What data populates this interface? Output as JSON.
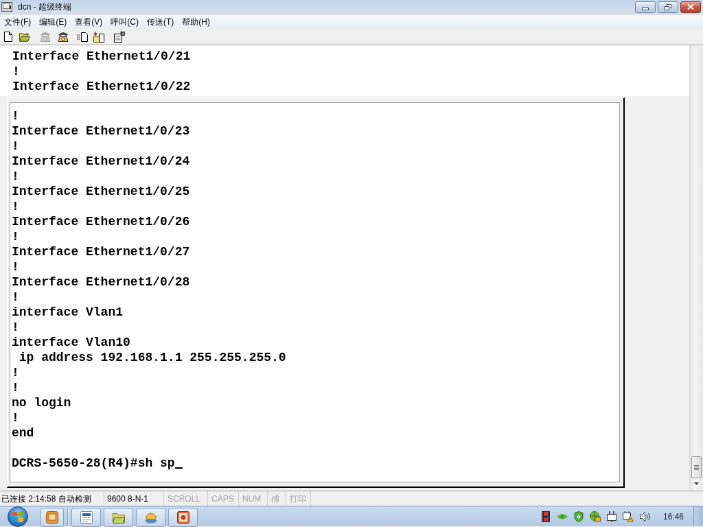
{
  "window": {
    "title": "dcn - 超级终端"
  },
  "menu": [
    "文件(F)",
    "编辑(E)",
    "查看(V)",
    "呼叫(C)",
    "传送(T)",
    "帮助(H)"
  ],
  "toolbar": [
    {
      "kind": "new",
      "disabled": false
    },
    {
      "kind": "open",
      "disabled": false
    },
    {
      "kind": "call",
      "disabled": true
    },
    {
      "kind": "hangup",
      "disabled": false
    },
    {
      "kind": "send",
      "disabled": false
    },
    {
      "kind": "receive",
      "disabled": false
    },
    {
      "kind": "properties",
      "disabled": false
    }
  ],
  "terminal": {
    "scrollback": [
      "Interface Ethernet1/0/21",
      "!",
      "Interface Ethernet1/0/22"
    ],
    "lines": [
      "!",
      "Interface Ethernet1/0/23",
      "!",
      "Interface Ethernet1/0/24",
      "!",
      "Interface Ethernet1/0/25",
      "!",
      "Interface Ethernet1/0/26",
      "!",
      "Interface Ethernet1/0/27",
      "!",
      "Interface Ethernet1/0/28",
      "!",
      "interface Vlan1",
      "!",
      "interface Vlan10",
      " ip address 192.168.1.1 255.255.255.0",
      "!",
      "!",
      "no login",
      "!",
      "end"
    ],
    "prompt": "DCRS-5650-28(R4)#sh sp"
  },
  "status_bar": {
    "connection": "已连接 2:14:58 自动检测",
    "port_settings": "9600 8-N-1",
    "indicators": [
      {
        "label": "SCROLL",
        "active": false
      },
      {
        "label": "CAPS",
        "active": false
      },
      {
        "label": "NUM",
        "active": false
      },
      {
        "label": "捕",
        "active": false
      },
      {
        "label": "打印",
        "active": false
      }
    ]
  },
  "taskbar": {
    "clock": "16:46"
  }
}
